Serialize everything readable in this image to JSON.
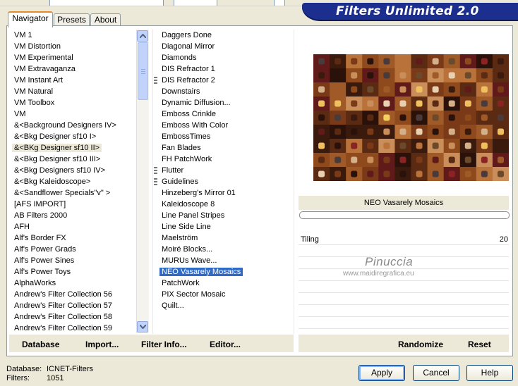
{
  "banner": {
    "title": "Filters Unlimited 2.0"
  },
  "tabs": [
    {
      "label": "Navigator",
      "active": true
    },
    {
      "label": "Presets",
      "active": false
    },
    {
      "label": "About",
      "active": false
    }
  ],
  "categories": [
    "VM 1",
    "VM Distortion",
    "VM Experimental",
    "VM Extravaganza",
    "VM Instant Art",
    "VM Natural",
    "VM Toolbox",
    "VM",
    "&<Background Designers IV>",
    "&<Bkg Designer sf10 I>",
    "&<BKg Designer sf10 II>",
    "&<Bkg Designer sf10 III>",
    "&<Bkg Designers sf10 IV>",
    "&<Bkg Kaleidoscope>",
    "&<Sandflower Specials\"v\" >",
    "[AFS IMPORT]",
    "AB Filters 2000",
    "AFH",
    "Alf's Border FX",
    "Alf's Power Grads",
    "Alf's Power Sines",
    "Alf's Power Toys",
    "AlphaWorks",
    "Andrew's Filter Collection 56",
    "Andrew's Filter Collection 57",
    "Andrew's Filter Collection 58",
    "Andrew's Filter Collection 59"
  ],
  "selected_category": "&<BKg Designer sf10 II>",
  "filters": [
    {
      "label": "Daggers Done",
      "marker": false
    },
    {
      "label": "Diagonal Mirror",
      "marker": false
    },
    {
      "label": "Diamonds",
      "marker": false
    },
    {
      "label": "DIS Refractor 1",
      "marker": false
    },
    {
      "label": "DIS Refractor 2",
      "marker": true
    },
    {
      "label": "Downstairs",
      "marker": false
    },
    {
      "label": "Dynamic Diffusion...",
      "marker": false
    },
    {
      "label": "Emboss Crinkle",
      "marker": false
    },
    {
      "label": "Emboss With Color",
      "marker": false
    },
    {
      "label": "EmbossTimes",
      "marker": false
    },
    {
      "label": "Fan Blades",
      "marker": false
    },
    {
      "label": "FH PatchWork",
      "marker": false
    },
    {
      "label": "Flutter",
      "marker": true
    },
    {
      "label": "Guidelines",
      "marker": true
    },
    {
      "label": "Hinzeberg's Mirror 01",
      "marker": false
    },
    {
      "label": "Kaleidoscope 8",
      "marker": false
    },
    {
      "label": "Line Panel Stripes",
      "marker": false
    },
    {
      "label": "Line Side Line",
      "marker": false
    },
    {
      "label": "Maelström",
      "marker": false
    },
    {
      "label": "Moiré Blocks...",
      "marker": false
    },
    {
      "label": "MURUs Wave...",
      "marker": false
    },
    {
      "label": "NEO Vasarely Mosaics",
      "marker": false
    },
    {
      "label": "PatchWork",
      "marker": false
    },
    {
      "label": "PIX Sector Mosaic",
      "marker": false
    },
    {
      "label": "Quilt...",
      "marker": false
    }
  ],
  "selected_filter": "NEO Vasarely Mosaics",
  "left_buttons": {
    "database": "Database",
    "import": "Import...",
    "filter_info": "Filter Info...",
    "editor": "Editor..."
  },
  "preview": {
    "filter_name": "NEO Vasarely Mosaics"
  },
  "parameters": [
    {
      "label": "Tiling",
      "value": "20"
    }
  ],
  "right_buttons": {
    "randomize": "Randomize",
    "reset": "Reset"
  },
  "watermark": {
    "name": "Pinuccia",
    "url": "www.maidiregrafica.eu"
  },
  "status": {
    "database_label": "Database:",
    "database_value": "ICNET-Filters",
    "filters_label": "Filters:",
    "filters_value": "1051"
  },
  "dialog_buttons": {
    "apply": "Apply",
    "cancel": "Cancel",
    "help": "Help"
  },
  "colors": {
    "banner": "#1c2f8e",
    "selection": "#316ac5",
    "tab_accent": "#e68b2c"
  },
  "icons": {
    "scroll_up": "scroll-up-arrow-icon",
    "scroll_down": "scroll-down-arrow-icon"
  }
}
